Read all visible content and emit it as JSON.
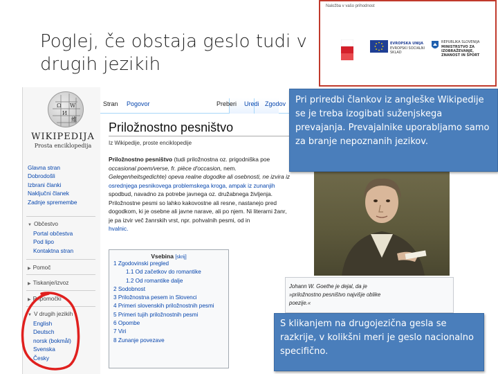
{
  "slide": {
    "title": "Poglej, če obstaja geslo tudi v drugih jezikih"
  },
  "logos": {
    "funder_text": "Naložba v vašo prihodnost",
    "eu_text": "EVROPSKA UNIJA",
    "eu_subtext": "EVROPSKI SOCIALNI SKLAD",
    "ministry_text": "MINISTRSTVO ZA IZOBRAŽEVANJE, ZNANOST IN ŠPORT",
    "ministry_prefix": "REPUBLIKA SLOVENIJA"
  },
  "wiki": {
    "wordmark": "WIKIPEDIJA",
    "tagline": "Prosta enciklopedija",
    "nav_main": [
      "Glavna stran",
      "Dobrodošli",
      "Izbrani članki",
      "Naključni članek",
      "Zadnje spremembe"
    ],
    "community_head": "Občestvo",
    "community_items": [
      "Portal občestva",
      "Pod lipo",
      "Kontaktna stran"
    ],
    "help_head": "Pomoč",
    "print_head": "Tiskanje/izvoz",
    "tools_head": "Pripomočki",
    "lang_head": "V drugih jezikih",
    "languages": [
      "English",
      "Deutsch",
      "norsk (bokmål)",
      "Svenska",
      "Česky"
    ],
    "tabs": {
      "page": "Stran",
      "talk": "Pogovor",
      "read": "Preberi",
      "edit": "Uredi",
      "history": "Zgodov"
    },
    "article_title": "Priložnostno pesništvo",
    "from": "Iz Wikipedije, proste enciklopedije",
    "body_lines": [
      {
        "a": "Priložnostno pesništvo",
        "b": " (tudi priložnostna oz. prigodniška poe"
      },
      {
        "a": "",
        "b": "nem. "
      },
      {
        "a": "",
        "b": "Gelegenheitsgedichte) opeva realne dogodke ali osebnosti, ne izvira iz"
      },
      {
        "a": "",
        "b": "osrednjega pesnikovega problemskega kroga, ampak iz zunanjih"
      },
      {
        "a": "",
        "b": "spodbud, navadno za potrebe javnega oz. družabnega življenja."
      },
      {
        "a": "",
        "b": "Priložnostne pesmi so lahko kakovostne ali resne, nastanejo pred"
      },
      {
        "a": "",
        "b": "dogodkom, ki je osebne ali javne narave, ali po njem. Ni literarni žanr,"
      },
      {
        "a": "",
        "b": "je pa izvir več žanrskih vrst, npr. pohvalnih pesmi, od in"
      },
      {
        "a": "",
        "b": "hvalnic."
      }
    ],
    "body_line2_italic": "occasional poem/verse, fr. pièce d'occasion,",
    "toc": {
      "title": "Vsebina",
      "hide": "[skrij]",
      "items": [
        {
          "label": "1 Zgodovinski pregled",
          "sub": false
        },
        {
          "label": "1.1 Od začetkov do romantike",
          "sub": true
        },
        {
          "label": "1.2 Od romantike dalje",
          "sub": true
        },
        {
          "label": "2 Sodobnost",
          "sub": false
        },
        {
          "label": "3 Priložnostna pesem in Slovenci",
          "sub": false
        },
        {
          "label": "4 Primeri slovenskih priložnostnih pesmi",
          "sub": false
        },
        {
          "label": "5 Primeri tujih priložnostnih pesmi",
          "sub": false
        },
        {
          "label": "6 Opombe",
          "sub": false
        },
        {
          "label": "7 Viri",
          "sub": false
        },
        {
          "label": "8 Zunanje povezave",
          "sub": false
        }
      ]
    },
    "caption_lines": [
      "Johann W. Goethe je dejal, da je",
      "»priložnostno pesništvo najvišje oblike",
      "poezije.«"
    ]
  },
  "callouts": {
    "top": "Pri priredbi člankov iz angleške Wikipedije se je treba izogibati suženjskega prevajanja. Prevajalnike uporabljamo samo za branje nepoznanih jezikov.",
    "bottom": "S klikanjem na drugojezična gesla se razkrije, v kolikšni meri je geslo nacionalno specifično."
  },
  "colors": {
    "callout_bg": "#4a7ebb",
    "link": "#0645ad",
    "circle": "#e0201e",
    "logo_border": "#c0392b"
  }
}
